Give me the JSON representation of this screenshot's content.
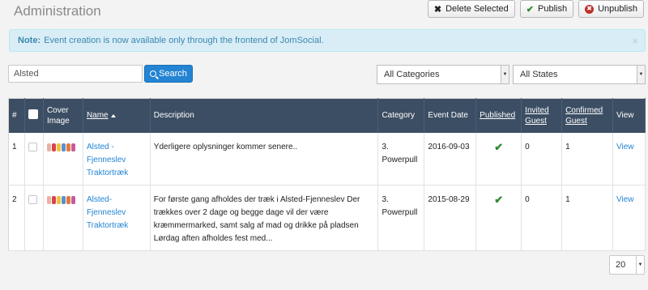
{
  "header": {
    "title": "Administration"
  },
  "toolbar": {
    "delete_label": "Delete Selected",
    "publish_label": "Publish",
    "unpublish_label": "Unpublish"
  },
  "alert": {
    "prefix": "Note:",
    "message": "Event creation is now available only through the frontend of JomSocial.",
    "close_glyph": "×"
  },
  "filters": {
    "search_value": "Alsted",
    "search_button": "Search",
    "category_selected": "All Categories",
    "state_selected": "All States"
  },
  "table": {
    "headers": {
      "num": "#",
      "cover": "Cover Image",
      "name": "Name",
      "description": "Description",
      "category": "Category",
      "event_date": "Event Date",
      "published": "Published",
      "invited": "Invited Guest",
      "confirmed": "Confirmed Guest",
      "view": "View"
    },
    "rows": [
      {
        "num": "1",
        "name": "Alsted -Fjenneslev Traktortræk",
        "description": "Yderligere oplysninger kommer senere..",
        "category": "3. Powerpull",
        "event_date": "2016-09-03",
        "published": "✔",
        "invited": "0",
        "confirmed": "1",
        "view": "View"
      },
      {
        "num": "2",
        "name": "Alsted-Fjenneslev Traktortræk",
        "description": "For første gang afholdes der træk i Alsted-Fjenneslev Der trækkes over 2 dage og begge dage vil der være kræmmermarked, samt salg af mad og drikke på pladsen Lørdag aften afholdes fest med...",
        "category": "3. Powerpull",
        "event_date": "2015-08-29",
        "published": "✔",
        "invited": "0",
        "confirmed": "1",
        "view": "View"
      }
    ]
  },
  "pagination": {
    "limit": "20"
  },
  "colors": {
    "header_bg": "#3c4e63",
    "link": "#2384d3",
    "search_button": "#2384d3",
    "alert_bg": "#d9edf7",
    "published_check": "#2d8a2d",
    "unpublish_icon": "#c0302c"
  }
}
